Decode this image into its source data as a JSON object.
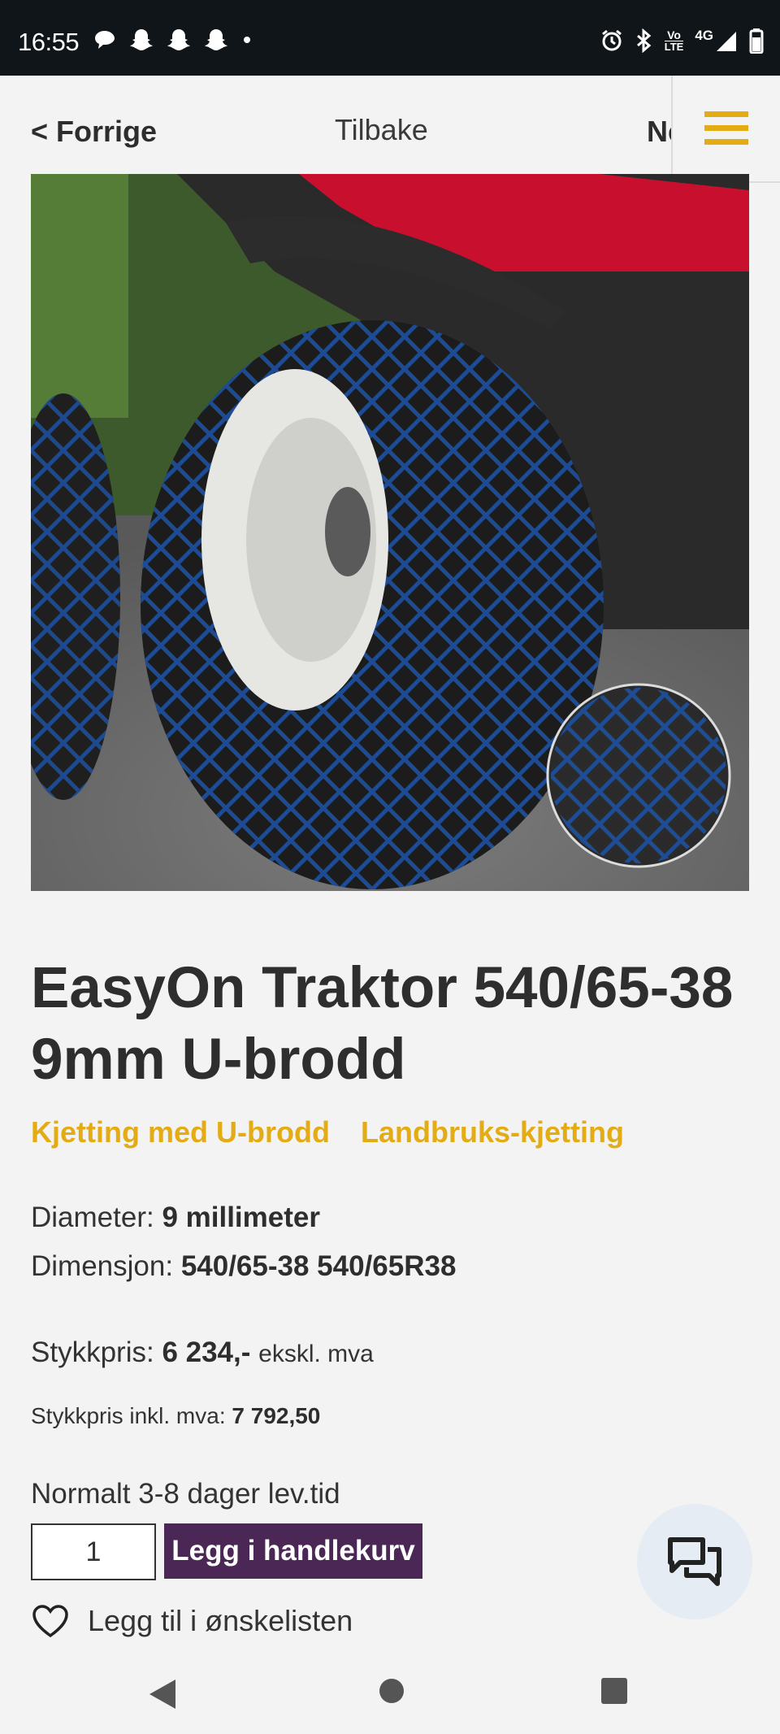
{
  "status_bar": {
    "time": "16:55",
    "left_icons": [
      "chat-bubble-icon",
      "snapchat-icon",
      "snapchat-icon",
      "snapchat-icon",
      "dot-icon"
    ],
    "right_icons": [
      "alarm-icon",
      "bluetooth-icon",
      "volte-icon",
      "signal-icon",
      "battery-icon"
    ],
    "volte_text_top": "Vo",
    "volte_text_bottom": "LTE",
    "network": "4G"
  },
  "nav": {
    "prev_label": "< Forrige",
    "back_label": "Tilbake",
    "next_label": "Ne",
    "menu_icon": "hamburger-menu-icon",
    "accent_color": "#e3ab14"
  },
  "product": {
    "image_alt": "Traktorhjul med blå snøkjetting",
    "title": "EasyOn Traktor 540/65-38 9mm U-brodd",
    "categories": [
      "Kjetting med U-brodd",
      "Landbruks-kjetting"
    ],
    "diameter_label": "Diameter:",
    "diameter_value": "9 millimeter",
    "dimension_label": "Dimensjon:",
    "dimension_value": "540/65-38 540/65R38",
    "unit_price_label": "Stykkpris:",
    "unit_price_value": "6 234,-",
    "unit_price_suffix": "ekskl. mva",
    "incl_vat_label": "Stykkpris inkl. mva:",
    "incl_vat_value": "7 792,50",
    "delivery_text": "Normalt 3-8 dager lev.tid",
    "quantity": "1",
    "add_to_cart_label": "Legg i handlekurv",
    "wishlist_label": "Legg til i ønskelisten",
    "button_color": "#4a2755"
  },
  "chat_fab_icon": "chat-icon",
  "system_nav": [
    "back-triangle-icon",
    "home-circle-icon",
    "recents-square-icon"
  ]
}
